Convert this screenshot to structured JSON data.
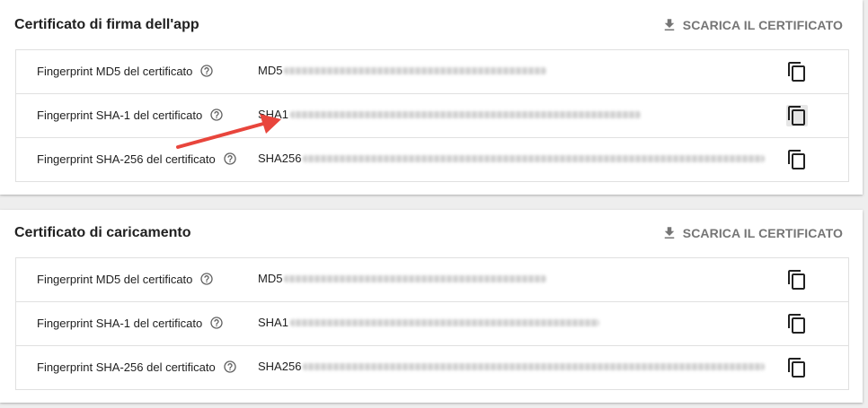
{
  "app_signing": {
    "title": "Certificato di firma dell'app",
    "download_label": "SCARICA IL CERTIFICATO",
    "rows": [
      {
        "label": "Fingerprint MD5 del certificato",
        "prefix": "MD5"
      },
      {
        "label": "Fingerprint SHA-1 del certificato",
        "prefix": "SHA1"
      },
      {
        "label": "Fingerprint SHA-256 del certificato",
        "prefix": "SHA256"
      }
    ]
  },
  "upload": {
    "title": "Certificato di caricamento",
    "download_label": "SCARICA IL CERTIFICATO",
    "rows": [
      {
        "label": "Fingerprint MD5 del certificato",
        "prefix": "MD5"
      },
      {
        "label": "Fingerprint SHA-1 del certificato",
        "prefix": "SHA1"
      },
      {
        "label": "Fingerprint SHA-256 del certificato",
        "prefix": "SHA256"
      }
    ]
  },
  "icons": {
    "download": "download-icon",
    "help": "help-circle-icon",
    "copy": "copy-icon",
    "annotation": "red-arrow"
  },
  "colors": {
    "annotation_arrow": "#e8453c",
    "button_text": "#757575"
  }
}
